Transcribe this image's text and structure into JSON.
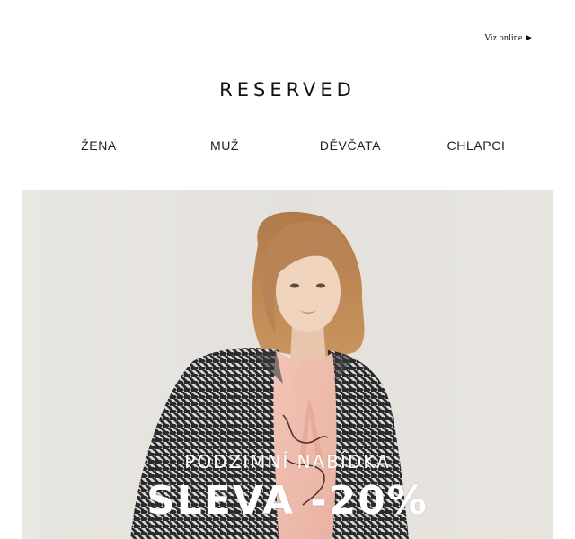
{
  "preheader": {
    "view_online": "Viz online ►"
  },
  "brand": {
    "logo_text": "RESERVED"
  },
  "nav": {
    "items": [
      {
        "label": "ŽENA"
      },
      {
        "label": "MUŽ"
      },
      {
        "label": "DĚVČATA"
      },
      {
        "label": "CHLAPCI"
      }
    ]
  },
  "hero": {
    "subtitle": "PODZIMNÍ NABÍDKA",
    "title": "SLEVA -20%",
    "background_color": "#e6e3de",
    "text_color": "#ffffff"
  }
}
